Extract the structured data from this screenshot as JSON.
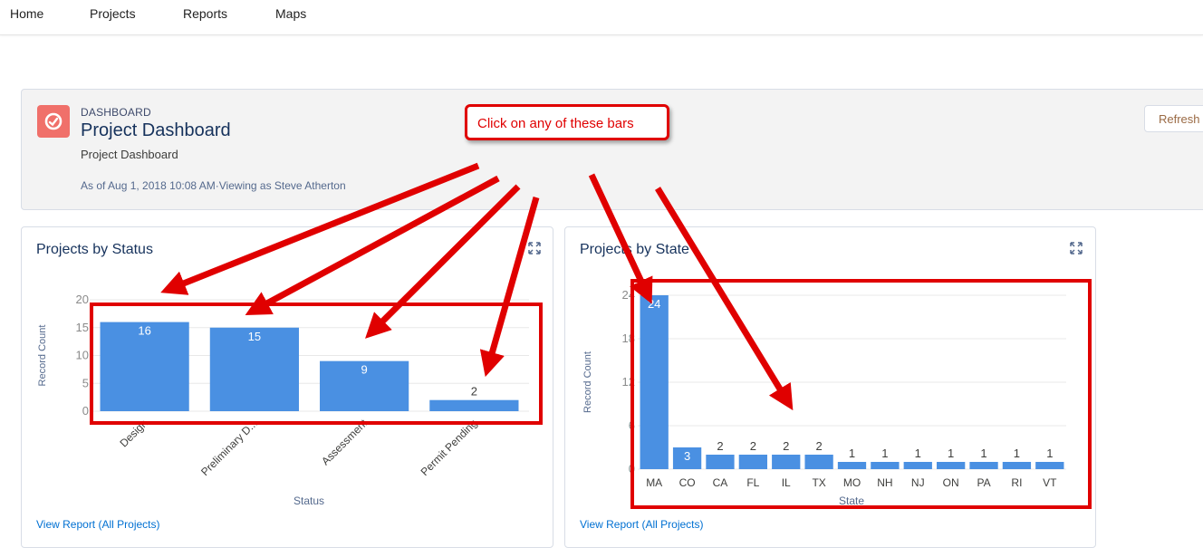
{
  "nav": {
    "items": [
      "Home",
      "Projects",
      "Reports",
      "Maps"
    ]
  },
  "header": {
    "eyebrow": "DASHBOARD",
    "title": "Project Dashboard",
    "subtitle": "Project Dashboard",
    "as_of": "As of Aug 1, 2018 10:08 AM·Viewing as Steve Atherton",
    "refresh_label": "Refresh"
  },
  "cards": [
    {
      "title": "Projects by Status",
      "view_report": "View Report (All Projects)"
    },
    {
      "title": "Projects by State",
      "view_report": "View Report (All Projects)"
    }
  ],
  "annotation": {
    "callout": "Click on any of these bars",
    "color": "#e00000"
  },
  "colors": {
    "bar": "#4a90e2",
    "accent": "#0070d2",
    "icon_bg": "#f0706a"
  },
  "chart_data": [
    {
      "type": "bar",
      "title": "Projects by Status",
      "xlabel": "Status",
      "ylabel": "Record Count",
      "categories": [
        "Design",
        "Preliminary D...",
        "Assessment",
        "Permit Pending"
      ],
      "values": [
        16,
        15,
        9,
        2
      ],
      "yticks": [
        0,
        5,
        10,
        15,
        20
      ],
      "ylim": [
        0,
        20
      ]
    },
    {
      "type": "bar",
      "title": "Projects by State",
      "xlabel": "State",
      "ylabel": "Record Count",
      "categories": [
        "MA",
        "CO",
        "CA",
        "FL",
        "IL",
        "TX",
        "MO",
        "NH",
        "NJ",
        "ON",
        "PA",
        "RI",
        "VT"
      ],
      "values": [
        24,
        3,
        2,
        2,
        2,
        2,
        1,
        1,
        1,
        1,
        1,
        1,
        1
      ],
      "yticks": [
        0,
        6,
        12,
        18,
        24
      ],
      "ylim": [
        0,
        24
      ]
    }
  ]
}
